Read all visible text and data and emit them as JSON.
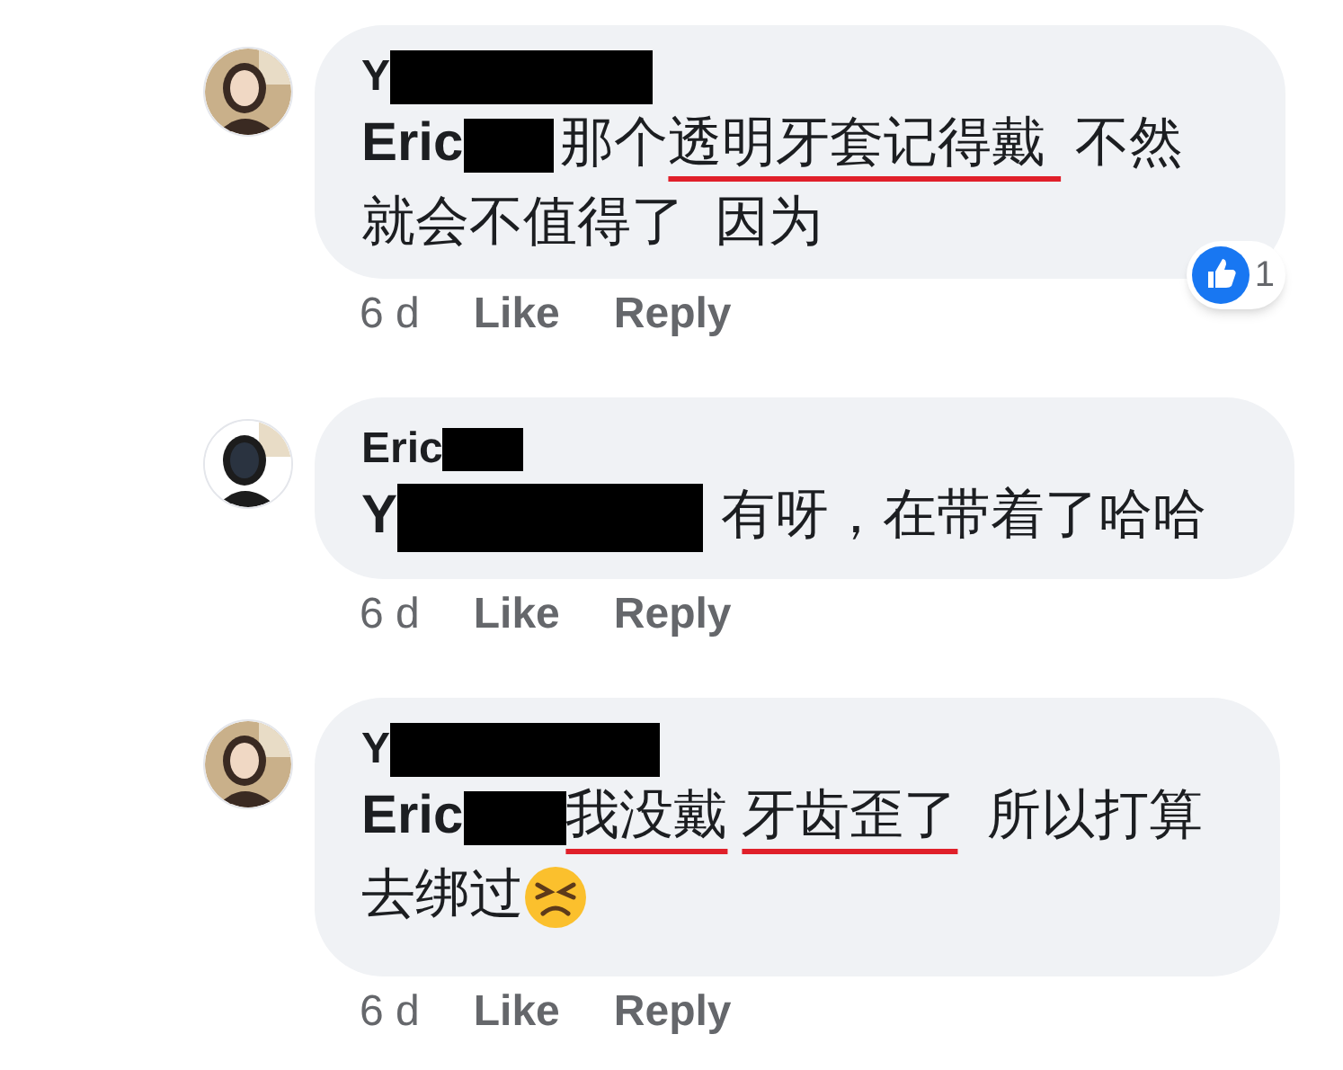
{
  "comments": [
    {
      "author": [
        {
          "kind": "text",
          "text": "Y"
        },
        {
          "kind": "redaction"
        }
      ],
      "body": [
        {
          "kind": "mention",
          "text": "Eric"
        },
        {
          "kind": "redaction"
        },
        {
          "kind": "text",
          "text": "那个"
        },
        {
          "kind": "underlined",
          "text": "透明牙套记得戴 "
        },
        {
          "kind": "text",
          "text": "不然就会不值得了  因为"
        }
      ],
      "time": "6 d",
      "actions": [
        "Like",
        "Reply"
      ],
      "reaction_count": "1"
    },
    {
      "author": [
        {
          "kind": "text",
          "text": "Eric"
        },
        {
          "kind": "redaction"
        }
      ],
      "body": [
        {
          "kind": "mention",
          "text": "Y"
        },
        {
          "kind": "redaction"
        },
        {
          "kind": "text",
          "text": "有呀，在带着了哈哈"
        }
      ],
      "time": "6 d",
      "actions": [
        "Like",
        "Reply"
      ]
    },
    {
      "author": [
        {
          "kind": "text",
          "text": "Y"
        },
        {
          "kind": "redaction"
        }
      ],
      "body": [
        {
          "kind": "mention",
          "text": "Eric"
        },
        {
          "kind": "redaction"
        },
        {
          "kind": "underlined",
          "text": "我没戴"
        },
        {
          "kind": "underlined",
          "text": "牙齿歪了"
        },
        {
          "kind": "text",
          "text": " 所以打算去绑过"
        },
        {
          "kind": "emoji"
        }
      ],
      "time": "6 d",
      "actions": [
        "Like",
        "Reply"
      ]
    }
  ]
}
